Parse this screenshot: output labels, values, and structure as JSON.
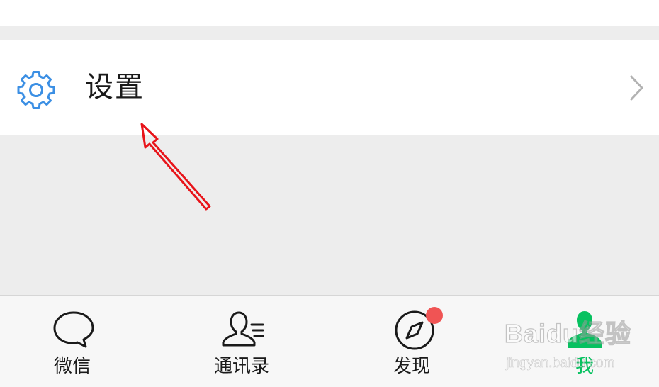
{
  "settings_row": {
    "icon": "gear-icon",
    "label": "设置",
    "chevron": "chevron-right-icon"
  },
  "tabbar": {
    "tabs": [
      {
        "label": "微信",
        "icon": "chat-bubble-icon",
        "active": false
      },
      {
        "label": "通讯录",
        "icon": "contacts-icon",
        "active": false
      },
      {
        "label": "发现",
        "icon": "compass-icon",
        "active": false,
        "badge_dot": true
      },
      {
        "label": "我",
        "icon": "person-icon",
        "active": true
      }
    ]
  },
  "watermark": {
    "main": "Baidu经验",
    "sub": "jingyan.baidu.com"
  },
  "colors": {
    "accent_green": "#07c160",
    "gear_blue": "#3b8fe4",
    "badge_red": "#f05454",
    "annotation_red": "#e8141a"
  }
}
